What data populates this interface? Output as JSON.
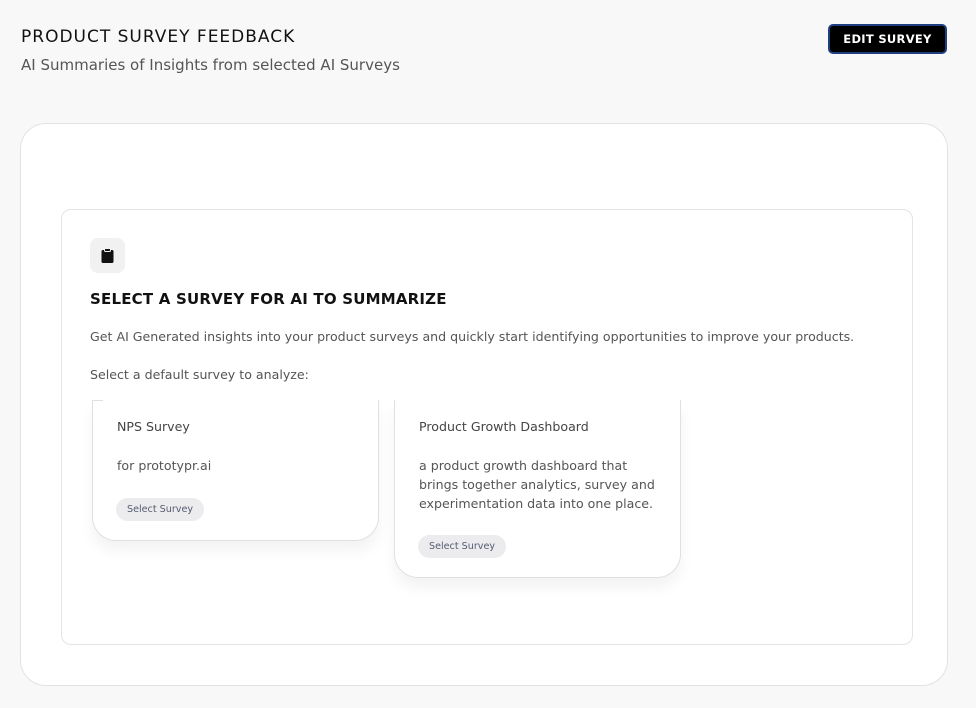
{
  "header": {
    "title": "PRODUCT SURVEY FEEDBACK",
    "subtitle": "AI Summaries of Insights from selected AI Surveys",
    "edit_button_label": "EDIT SURVEY"
  },
  "panel": {
    "icon": "clipboard-icon",
    "heading": "SELECT A SURVEY FOR AI TO SUMMARIZE",
    "description": "Get AI Generated insights into your product surveys and quickly start identifying opportunities to improve your products.",
    "select_prompt": "Select a default survey to analyze:"
  },
  "surveys": [
    {
      "title": "NPS Survey",
      "description": "for prototypr.ai",
      "button_label": "Select Survey"
    },
    {
      "title": "Product Growth Dashboard",
      "description": "a product growth dashboard that brings together analytics, survey and experimentation data into one place.",
      "button_label": "Select Survey"
    }
  ],
  "colors": {
    "background": "#f8f8f8",
    "primary_button": "#000000",
    "primary_button_border": "#1f3f80",
    "pill_button": "#ececee",
    "pill_text": "#555b70"
  }
}
